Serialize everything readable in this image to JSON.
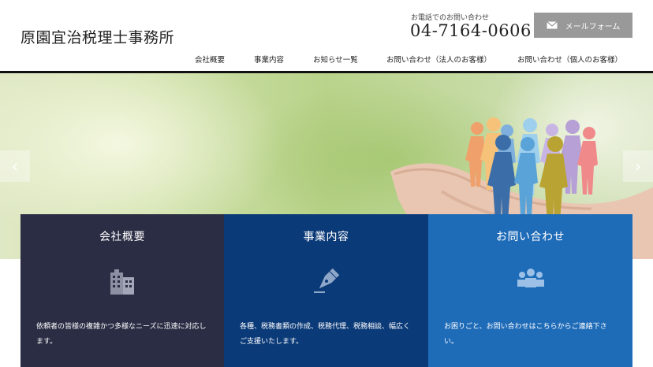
{
  "header": {
    "site_title": "原園宜治税理士事務所",
    "tel_caption": "お電話でのお問い合わせ",
    "tel_number": "04-7164-0606",
    "mail_button_label": "メールフォーム"
  },
  "nav": {
    "items": [
      {
        "label": "会社概要"
      },
      {
        "label": "事業内容"
      },
      {
        "label": "お知らせ一覧"
      },
      {
        "label": "お問い合わせ（法人のお客様）"
      },
      {
        "label": "お問い合わせ（個人のお客様）"
      }
    ]
  },
  "slider": {
    "prev_glyph": "‹",
    "next_glyph": "›"
  },
  "cards": [
    {
      "title": "会社概要",
      "icon": "building-icon",
      "text": "依頼者の皆様の複雑かつ多様なニーズに迅速に対応します。"
    },
    {
      "title": "事業内容",
      "icon": "pen-nib-icon",
      "text": "各種、税務書類の作成、税務代理、税務相談、幅広くご支援いたします。"
    },
    {
      "title": "お問い合わせ",
      "icon": "people-group-icon",
      "text": "お困りごと、お問い合わせはこちらからご連絡下さい。"
    }
  ],
  "colors": {
    "card_1": "#2a2d44",
    "card_2": "#0b3a78",
    "card_3": "#1e6bb8",
    "mail_button": "#999999"
  }
}
